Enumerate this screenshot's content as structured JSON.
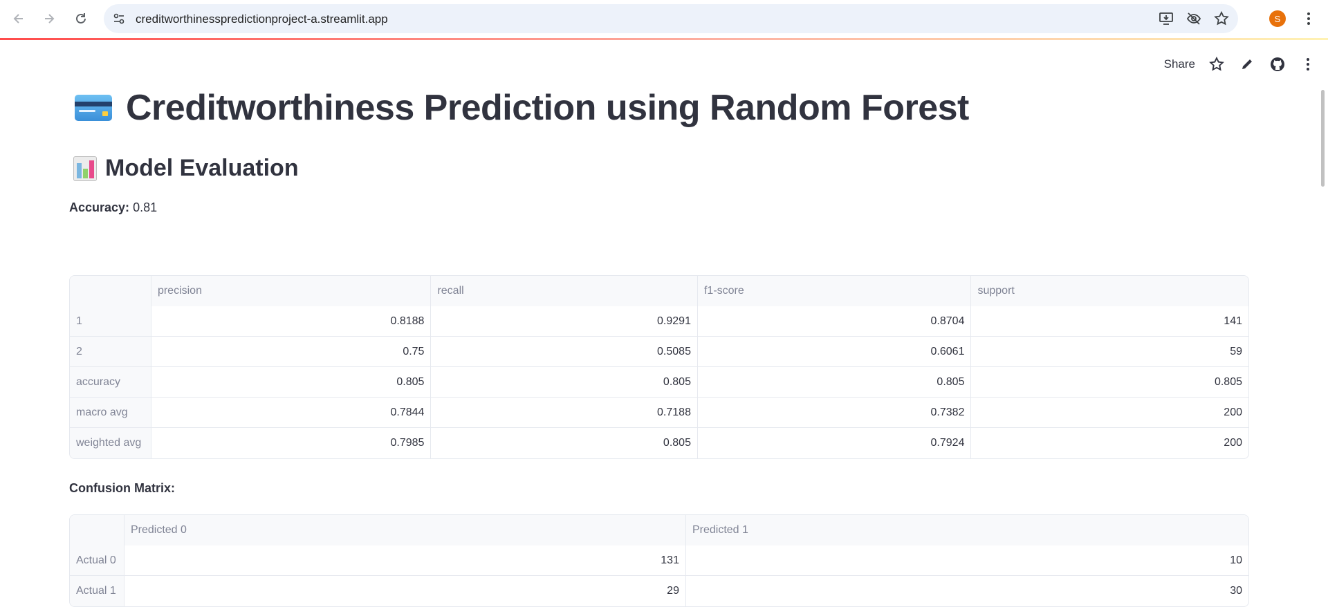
{
  "browser": {
    "url": "creditworthinesspredictionproject-a.streamlit.app",
    "profile_initial": "S"
  },
  "toolbar": {
    "share_label": "Share"
  },
  "page": {
    "title": "Creditworthiness Prediction using Random Forest",
    "title_icon": "credit-card-emoji",
    "section_title": "Model Evaluation",
    "section_icon": "bar-chart-emoji",
    "accuracy_label": "Accuracy:",
    "accuracy_value": "0.81",
    "confusion_label": "Confusion Matrix:"
  },
  "report_table": {
    "columns": [
      "",
      "precision",
      "recall",
      "f1-score",
      "support"
    ],
    "rows": [
      {
        "label": "1",
        "values": [
          "0.8188",
          "0.9291",
          "0.8704",
          "141"
        ]
      },
      {
        "label": "2",
        "values": [
          "0.75",
          "0.5085",
          "0.6061",
          "59"
        ]
      },
      {
        "label": "accuracy",
        "values": [
          "0.805",
          "0.805",
          "0.805",
          "0.805"
        ]
      },
      {
        "label": "macro avg",
        "values": [
          "0.7844",
          "0.7188",
          "0.7382",
          "200"
        ]
      },
      {
        "label": "weighted avg",
        "values": [
          "0.7985",
          "0.805",
          "0.7924",
          "200"
        ]
      }
    ]
  },
  "confusion_table": {
    "columns": [
      "",
      "Predicted 0",
      "Predicted 1"
    ],
    "rows": [
      {
        "label": "Actual 0",
        "values": [
          "131",
          "10"
        ]
      },
      {
        "label": "Actual 1",
        "values": [
          "29",
          "30"
        ]
      }
    ]
  },
  "colors": {
    "text": "#31333f",
    "muted": "#808495",
    "border": "#e6e9ef",
    "header_bg": "#f8f9fb",
    "accent": "#ff4b4b"
  }
}
